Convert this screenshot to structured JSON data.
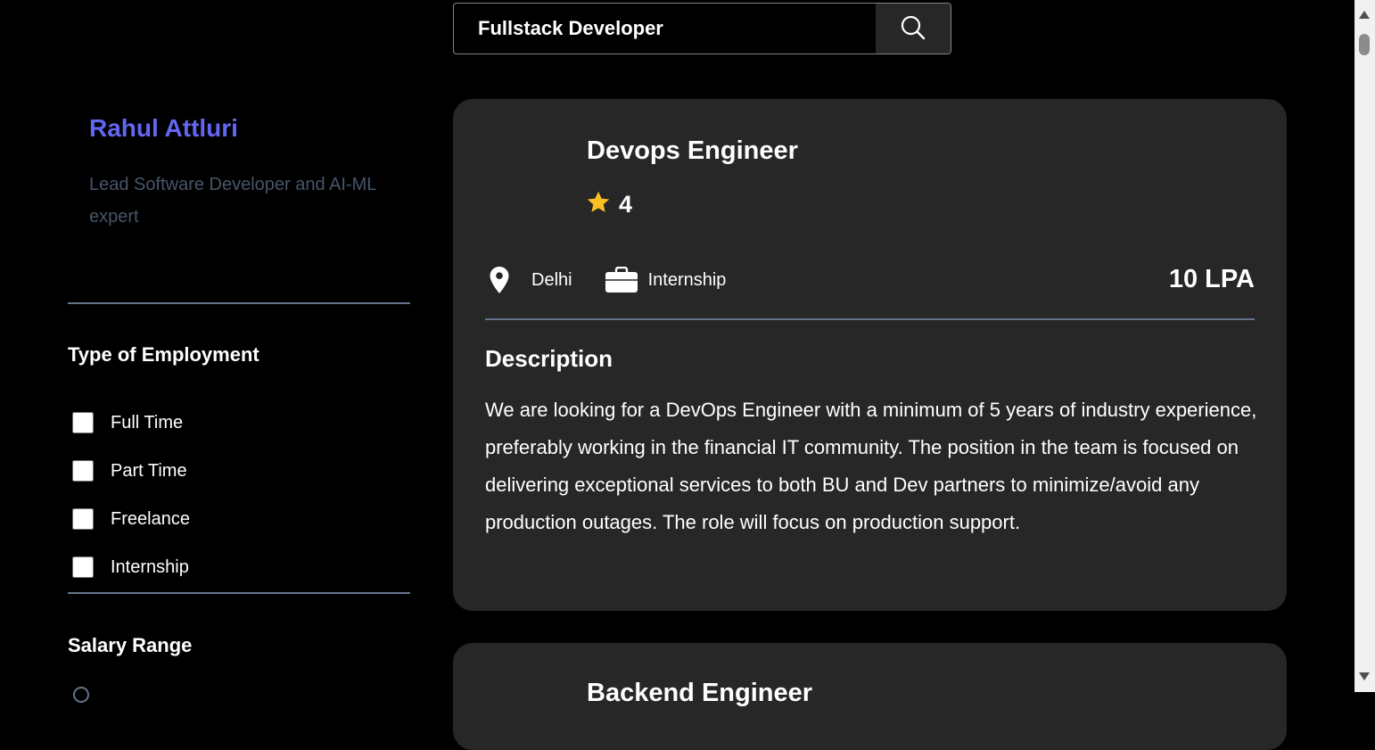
{
  "search": {
    "value": "Fullstack Developer",
    "icon": "search-icon"
  },
  "profile": {
    "name": "Rahul Attluri",
    "bio": "Lead Software Developer and AI-ML expert"
  },
  "filters": {
    "employment_title": "Type of Employment",
    "employment_options": [
      {
        "label": "Full Time",
        "checked": false
      },
      {
        "label": "Part Time",
        "checked": false
      },
      {
        "label": "Freelance",
        "checked": false
      },
      {
        "label": "Internship",
        "checked": false
      }
    ],
    "salary_title": "Salary Range"
  },
  "jobs": [
    {
      "title": "Devops Engineer",
      "rating": "4",
      "location": "Delhi",
      "employment_type": "Internship",
      "package": "10 LPA",
      "description_title": "Description",
      "description": "We are looking for a DevOps Engineer with a minimum of 5 years of industry experience, preferably working in the financial IT community. The position in the team is focused on delivering exceptional services to both BU and Dev partners to minimize/avoid any production outages. The role will focus on production support."
    },
    {
      "title": "Backend Engineer"
    }
  ],
  "colors": {
    "accent": "#6366f1",
    "bio": "#475569",
    "card": "#272727",
    "star": "#fbbf24",
    "divider": "#64748b"
  }
}
